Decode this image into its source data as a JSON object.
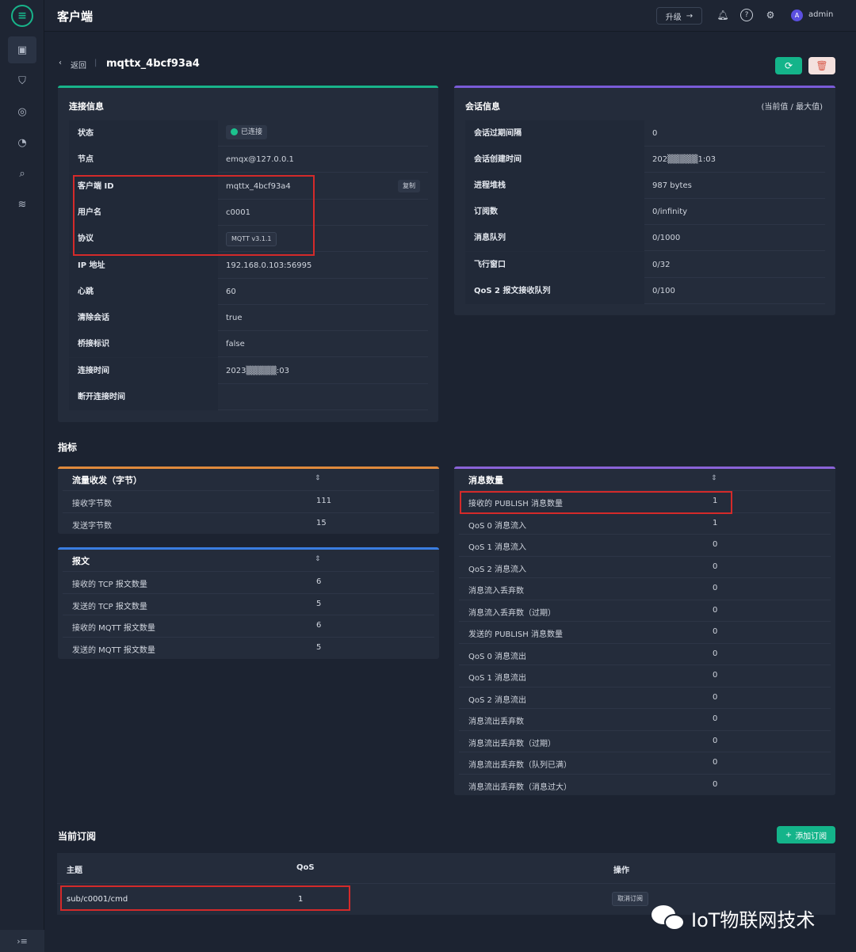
{
  "app": {
    "title": "客户端",
    "upgrade_label": "升级",
    "user": "admin",
    "avatar_letter": "A"
  },
  "nav": {
    "collapse_label": "›≡"
  },
  "breadcrumb": {
    "back_label": "返回",
    "title": "mqttx_4bcf93a4"
  },
  "connection_info": {
    "title": "连接信息",
    "copy_label": "复制",
    "rows": [
      {
        "key": "状态",
        "value": "已连接"
      },
      {
        "key": "节点",
        "value": "emqx@127.0.0.1"
      },
      {
        "key": "客户端 ID",
        "value": "mqttx_4bcf93a4"
      },
      {
        "key": "用户名",
        "value": "c0001"
      },
      {
        "key": "协议",
        "value": "MQTT v3.1.1"
      },
      {
        "key": "IP 地址",
        "value": "192.168.0.103:56995"
      },
      {
        "key": "心跳",
        "value": "60"
      },
      {
        "key": "清除会话",
        "value": "true"
      },
      {
        "key": "桥接标识",
        "value": "false"
      },
      {
        "key": "连接时间",
        "value": "2023▒▒▒▒▒:03"
      },
      {
        "key": "断开连接时间",
        "value": ""
      }
    ]
  },
  "session_info": {
    "title": "会话信息",
    "note": "(当前值 / 最大值)",
    "rows": [
      {
        "key": "会话过期间隔",
        "value": "0"
      },
      {
        "key": "会话创建时间",
        "value": "202▒▒▒▒▒1:03"
      },
      {
        "key": "进程堆栈",
        "value": "987 bytes"
      },
      {
        "key": "订阅数",
        "value": "0/infinity"
      },
      {
        "key": "消息队列",
        "value": "0/1000"
      },
      {
        "key": "飞行窗口",
        "value": "0/32"
      },
      {
        "key": "QoS 2 报文接收队列",
        "value": "0/100"
      }
    ]
  },
  "metrics": {
    "title": "指标",
    "traffic": {
      "title": "流量收发（字节）",
      "rows": [
        {
          "label": "接收字节数",
          "value": "111"
        },
        {
          "label": "发送字节数",
          "value": "15"
        }
      ]
    },
    "packets": {
      "title": "报文",
      "rows": [
        {
          "label": "接收的 TCP 报文数量",
          "value": "6"
        },
        {
          "label": "发送的 TCP 报文数量",
          "value": "5"
        },
        {
          "label": "接收的 MQTT 报文数量",
          "value": "6"
        },
        {
          "label": "发送的 MQTT 报文数量",
          "value": "5"
        }
      ]
    },
    "messages": {
      "title": "消息数量",
      "rows": [
        {
          "label": "接收的 PUBLISH 消息数量",
          "value": "1"
        },
        {
          "label": "QoS 0 消息流入",
          "value": "1"
        },
        {
          "label": "QoS 1 消息流入",
          "value": "0"
        },
        {
          "label": "QoS 2 消息流入",
          "value": "0"
        },
        {
          "label": "消息流入丢弃数",
          "value": "0"
        },
        {
          "label": "消息流入丢弃数（过期）",
          "value": "0"
        },
        {
          "label": "发送的 PUBLISH 消息数量",
          "value": "0"
        },
        {
          "label": "QoS 0 消息流出",
          "value": "0"
        },
        {
          "label": "QoS 1 消息流出",
          "value": "0"
        },
        {
          "label": "QoS 2 消息流出",
          "value": "0"
        },
        {
          "label": "消息流出丢弃数",
          "value": "0"
        },
        {
          "label": "消息流出丢弃数（过期）",
          "value": "0"
        },
        {
          "label": "消息流出丢弃数（队列已满）",
          "value": "0"
        },
        {
          "label": "消息流出丢弃数（消息过大）",
          "value": "0"
        }
      ]
    }
  },
  "subscriptions": {
    "title": "当前订阅",
    "add_label": "添加订阅",
    "columns": {
      "topic": "主题",
      "qos": "QoS",
      "actions": "操作"
    },
    "rows": [
      {
        "topic": "sub/c0001/cmd",
        "qos": "1",
        "action_label": "取消订阅"
      }
    ]
  },
  "watermark": {
    "text": "IoT物联网技术"
  },
  "colors": {
    "accent": "#14b48a",
    "danger": "#d85a4a",
    "highlight": "#d42a2a",
    "conn_line": "#18b48a",
    "session_line": "#7a5bd8",
    "traffic_line": "#e08a3c",
    "packets_line": "#3a7de0",
    "messages_line": "#8a63d8"
  }
}
